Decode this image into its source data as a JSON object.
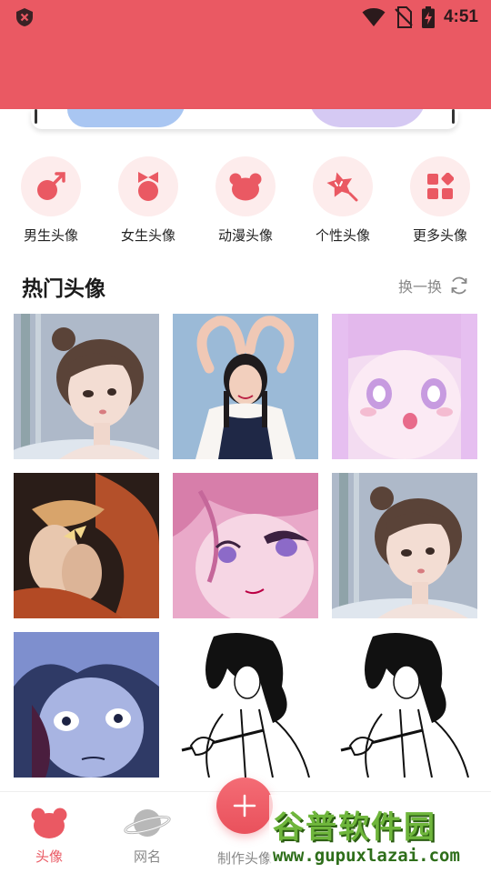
{
  "status_bar": {
    "time": "4:51",
    "icons": [
      "shield-icon",
      "wifi-icon",
      "no-sim-icon",
      "battery-charging-icon"
    ]
  },
  "categories": [
    {
      "label": "男生头像",
      "icon": "male-symbol-icon"
    },
    {
      "label": "女生头像",
      "icon": "female-bow-icon"
    },
    {
      "label": "动漫头像",
      "icon": "bear-head-icon"
    },
    {
      "label": "个性头像",
      "icon": "star-icon"
    },
    {
      "label": "更多头像",
      "icon": "more-grid-icon"
    }
  ],
  "hot_section": {
    "title": "热门头像",
    "refresh_label": "换一换"
  },
  "grid_tiles": [
    {
      "subject": "illustrated girl with hair bun",
      "palette": [
        "#a9b5c7",
        "#f1e3dd"
      ]
    },
    {
      "subject": "girl making heart with arms",
      "palette": [
        "#8fb1cf",
        "#1f2540"
      ]
    },
    {
      "subject": "anime girl purple eyes",
      "palette": [
        "#f3d7f0",
        "#c8a2e0"
      ]
    },
    {
      "subject": "hands with butterfly",
      "palette": [
        "#2a1c17",
        "#c5673e"
      ]
    },
    {
      "subject": "pink anime girl",
      "palette": [
        "#e7a4c7",
        "#f6d4e3"
      ]
    },
    {
      "subject": "illustrated girl with hair bun",
      "palette": [
        "#a9b5c7",
        "#f1e3dd"
      ]
    },
    {
      "subject": "anime girl blue tint",
      "palette": [
        "#6f7fb8",
        "#27305a"
      ]
    },
    {
      "subject": "manga boy sketch",
      "palette": [
        "#ffffff",
        "#111111"
      ]
    },
    {
      "subject": "manga boy sketch",
      "palette": [
        "#ffffff",
        "#111111"
      ]
    }
  ],
  "tabbar": {
    "tabs": [
      {
        "label": "头像",
        "icon": "bear-head-icon",
        "active": true
      },
      {
        "label": "网名",
        "icon": "planet-icon",
        "active": false
      },
      {
        "label": "制作头像",
        "icon": "plus-icon",
        "active": false
      }
    ]
  },
  "watermark": {
    "title": "谷普软件园",
    "url": "www.gupuxlazai.com"
  },
  "colors": {
    "accent": "#ea5963",
    "category_bg": "#fdecec"
  }
}
